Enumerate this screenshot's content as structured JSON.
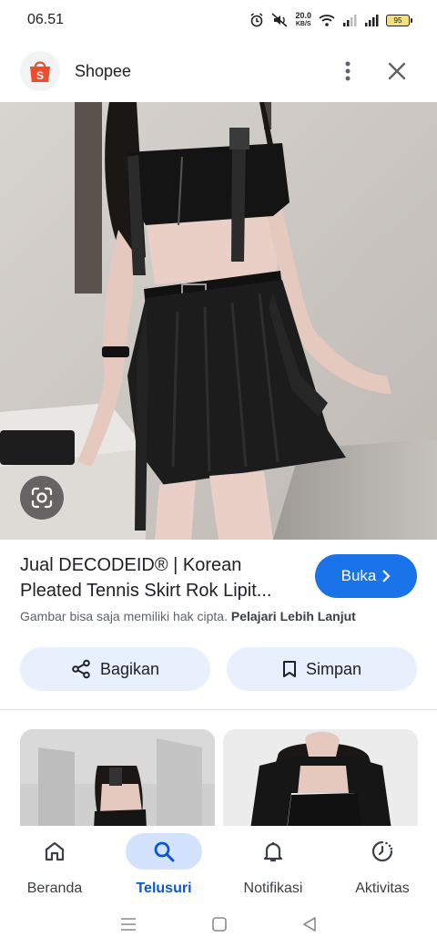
{
  "status_bar": {
    "time": "06.51",
    "net_speed_value": "20.0",
    "net_speed_unit": "KB/S",
    "battery": "95"
  },
  "header": {
    "app_name": "Shopee"
  },
  "product": {
    "title": "Jual DECODEID® | Korean Pleated Tennis Skirt Rok Lipit...",
    "open_label": "Buka",
    "copyright_notice": "Gambar bisa saja memiliki hak cipta.",
    "learn_more": "Pelajari Lebih Lanjut"
  },
  "actions": {
    "share_label": "Bagikan",
    "save_label": "Simpan"
  },
  "bottom_nav": {
    "items": [
      {
        "label": "Beranda",
        "icon": "home-icon",
        "active": false
      },
      {
        "label": "Telusuri",
        "icon": "search-icon",
        "active": true
      },
      {
        "label": "Notifikasi",
        "icon": "bell-icon",
        "active": false
      },
      {
        "label": "Aktivitas",
        "icon": "activity-icon",
        "active": false
      }
    ]
  },
  "colors": {
    "accent": "#1a73e8",
    "chip_bg": "#e8f0fe",
    "active_nav": "#0b57d0",
    "shopee": "#ee4d2d"
  }
}
